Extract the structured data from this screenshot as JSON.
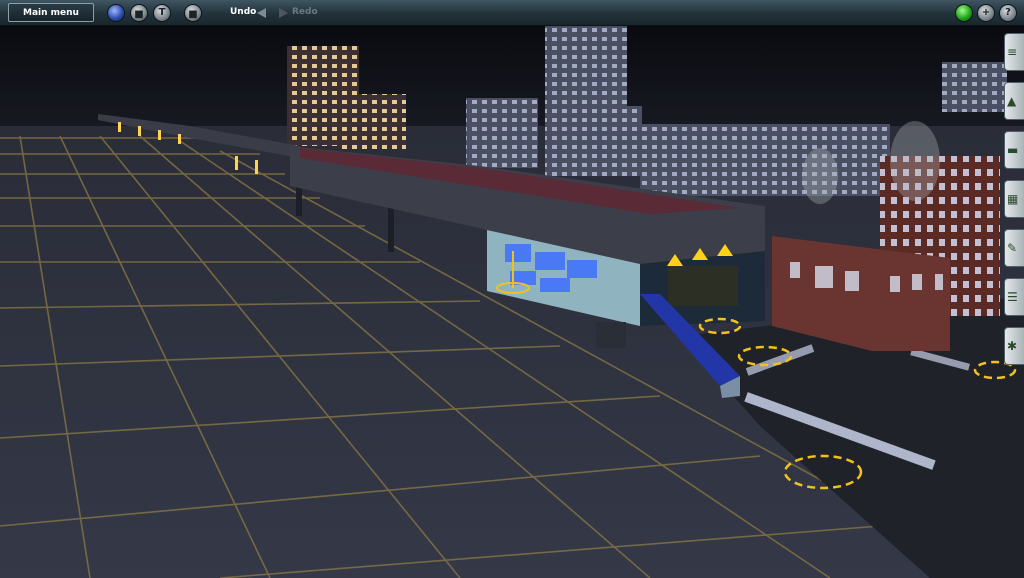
{
  "toolbar": {
    "main_menu_label": "Main menu",
    "undo_label": "Undo",
    "redo_label": "Redo",
    "left_icons": [
      "globe-icon",
      "toolbar-square-icon",
      "text-tool-icon",
      "options-icon"
    ],
    "right_icons": [
      "status-green-icon",
      "add-icon",
      "help-icon"
    ],
    "add_glyph": "+",
    "help_glyph": "?",
    "text_glyph": "T"
  },
  "side_panel": {
    "tools": [
      "track-tool-icon",
      "terrain-tool-icon",
      "train-tool-icon",
      "objects-tool-icon",
      "properties-tool-icon",
      "layers-tool-icon",
      "settings-tool-icon"
    ]
  },
  "colors": {
    "toolbar_bg": "#2a3c45",
    "ground_grid": "#2d3140",
    "grid_line": "#8c7a45",
    "sky": "#0d0f14",
    "roof": "#5a2a36",
    "window_light": "#ffe7a8",
    "marker_yellow": "#f2c21a"
  }
}
